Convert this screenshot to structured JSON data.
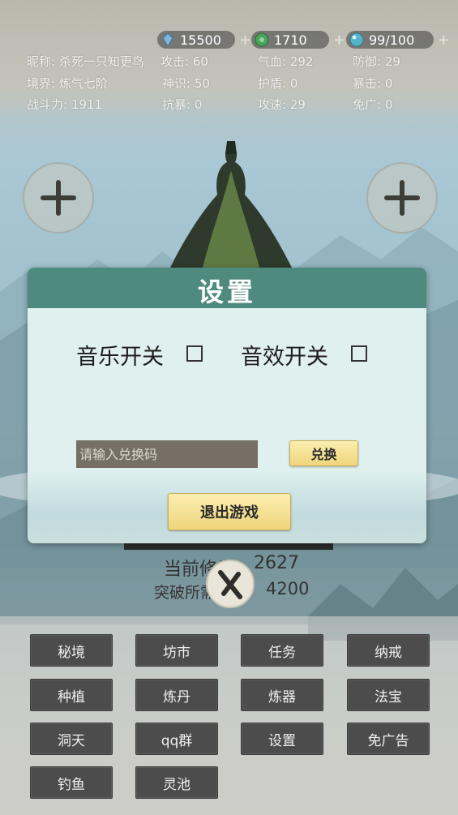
{
  "resources": {
    "crystal": {
      "value": "15500",
      "icon": "crystal-icon"
    },
    "jade": {
      "value": "1710",
      "icon": "jade-coin-icon"
    },
    "energy": {
      "value": "99/100",
      "icon": "energy-orb-icon"
    },
    "plus": "+"
  },
  "stats": {
    "nickname": "昵称: 杀死一只知更鸟",
    "attack": "攻击: 60",
    "hp": "气血: 292",
    "defense": "防御: 29",
    "realm": "境界: 炼气七阶",
    "spirit": "神识: 50",
    "shield": "护盾: 0",
    "crit": "暴击: 0",
    "power": "战斗力: 1911",
    "crit_resist": "抗暴: 0",
    "attack_speed": "攻速: 29",
    "ad_free": "免广: 0"
  },
  "cultivation": {
    "current_label": "当前修为:",
    "current_value": "2627",
    "breakthrough_label": "突破所需:",
    "breakthrough_value": "4200"
  },
  "dialog": {
    "title": "设置",
    "music_label": "音乐开关",
    "sound_label": "音效开关",
    "redeem_placeholder": "请输入兑换码",
    "redeem_button": "兑换",
    "exit_button": "退出游戏"
  },
  "menu": [
    {
      "label": "秘境"
    },
    {
      "label": "坊市"
    },
    {
      "label": "任务"
    },
    {
      "label": "纳戒"
    },
    {
      "label": "种植"
    },
    {
      "label": "炼丹"
    },
    {
      "label": "炼器"
    },
    {
      "label": "法宝"
    },
    {
      "label": "洞天"
    },
    {
      "label": "qq群"
    },
    {
      "label": "设置"
    },
    {
      "label": "免广告"
    },
    {
      "label": "钓鱼"
    },
    {
      "label": "灵池"
    }
  ],
  "colors": {
    "dialog_header": "#4e8b7e",
    "dialog_body": "#dff0ee",
    "menu_button": "#4c4c4c",
    "gold_button": "#efd57c"
  }
}
